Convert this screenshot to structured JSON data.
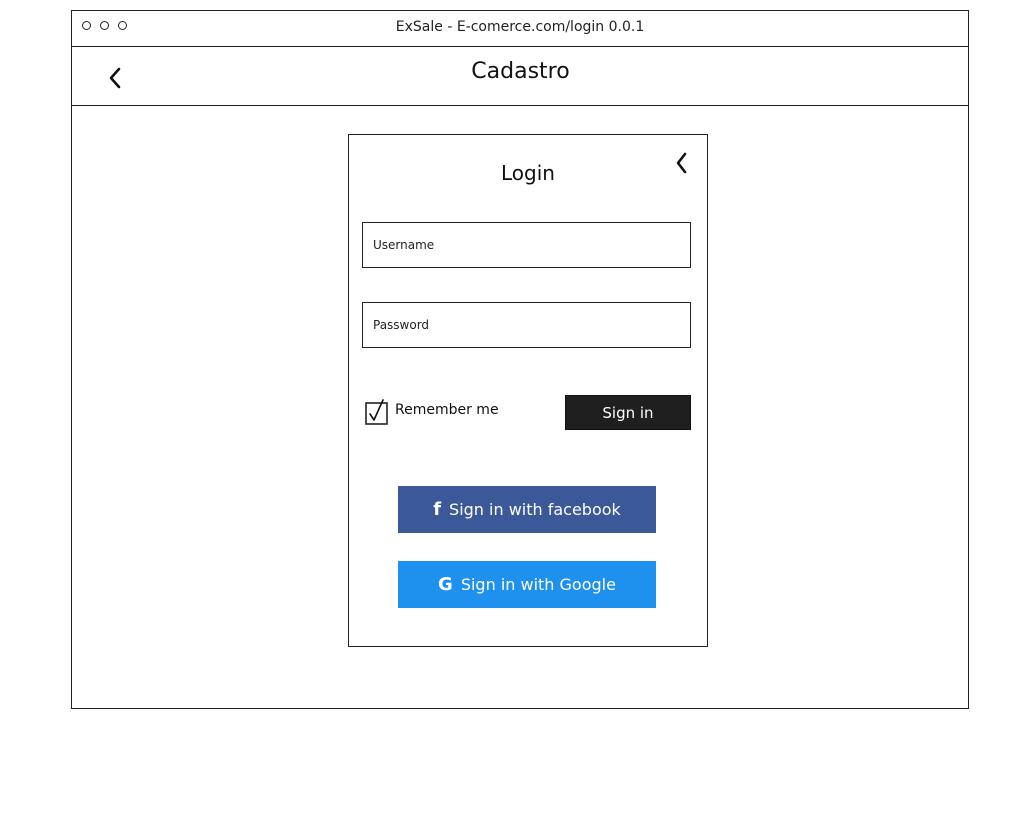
{
  "window": {
    "title": "ExSale - E-comerce.com/login 0.0.1"
  },
  "appbar": {
    "title": "Cadastro",
    "back_icon": "chevron-left-icon"
  },
  "login": {
    "title": "Login",
    "close_icon": "chevron-left-icon",
    "username_placeholder": "Username",
    "password_placeholder": "Password",
    "remember_label": "Remember me",
    "remember_checked": true,
    "signin_label": "Sign in",
    "facebook": {
      "icon": "facebook-icon",
      "icon_glyph": "f",
      "label": "Sign in with facebook",
      "color": "#3b5998"
    },
    "google": {
      "icon": "google-icon",
      "icon_glyph": "G",
      "label": "Sign in with Google",
      "color": "#1e90ee"
    }
  }
}
